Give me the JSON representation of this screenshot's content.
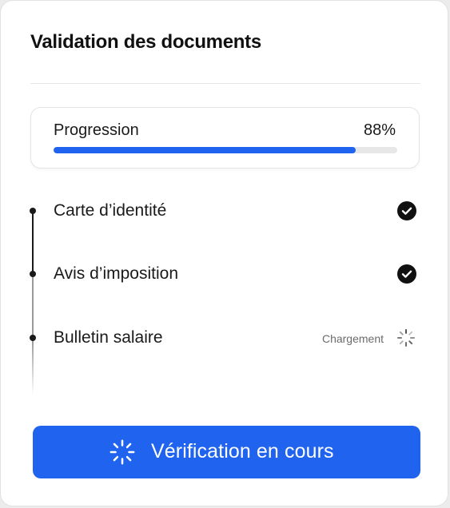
{
  "card": {
    "title": "Validation des documents"
  },
  "progress": {
    "label": "Progression",
    "value_text": "88%",
    "fraction": 0.88
  },
  "steps": [
    {
      "label": "Carte d’identité",
      "status": "done",
      "icon": "check-circle-icon"
    },
    {
      "label": "Avis d’imposition",
      "status": "done",
      "icon": "check-circle-icon"
    },
    {
      "label": "Bulletin salaire",
      "status": "loading",
      "status_text": "Chargement",
      "icon": "spinner-icon"
    }
  ],
  "button": {
    "label": "Vérification en cours",
    "icon": "spinner-icon"
  },
  "colors": {
    "accent": "#1f63ee",
    "text": "#1a1a1a",
    "muted": "#6b6b6b"
  }
}
